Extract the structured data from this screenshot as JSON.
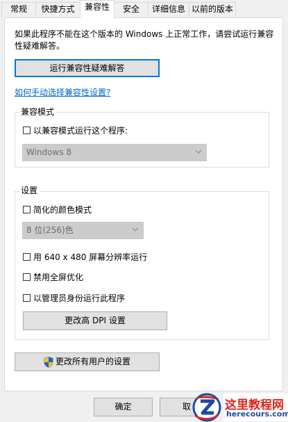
{
  "tabs": [
    "常规",
    "快捷方式",
    "兼容性",
    "安全",
    "详细信息",
    "以前的版本"
  ],
  "active_tab": "兼容性",
  "description": "如果此程序不能在这个版本的 Windows 上正常工作，请尝试运行兼容性疑难解答。",
  "troubleshooter_button": "运行兼容性疑难解答",
  "manual_link": "如何手动选择兼容性设置?",
  "compat_mode": {
    "group_title": "兼容模式",
    "checkbox_label": "以兼容模式运行这个程序:",
    "checked": false,
    "select_value": "Windows 8"
  },
  "settings": {
    "group_title": "设置",
    "reduced_color_label": "简化的颜色模式",
    "reduced_color_checked": false,
    "color_select_value": "8 位(256)色",
    "res_640_label": "用 640 x 480 屏幕分辨率运行",
    "res_640_checked": false,
    "disable_fullscreen_label": "禁用全屏优化",
    "disable_fullscreen_checked": false,
    "run_as_admin_label": "以管理员身份运行此程序",
    "run_as_admin_checked": false,
    "dpi_button": "更改高 DPI 设置"
  },
  "all_users_button": "更改所有用户的设置",
  "footer": {
    "ok_button": "确定",
    "cancel_button_partial": "取"
  },
  "watermark": {
    "title": "这里教程网",
    "url": "herecours.com"
  },
  "colors": {
    "link": "#0066cc",
    "focus_border": "#0078d7",
    "watermark_red": "#e0251b",
    "watermark_blue": "#1b4aa0"
  }
}
